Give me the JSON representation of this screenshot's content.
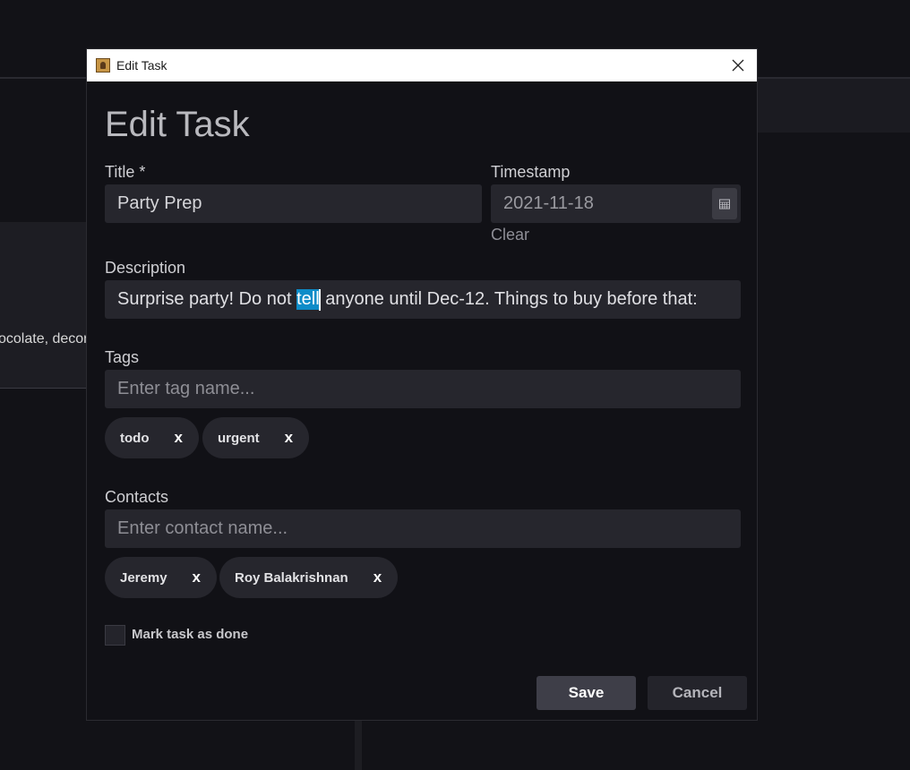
{
  "background": {
    "left_card_text": "ocolate, decorations, balloons"
  },
  "window": {
    "title": "Edit Task",
    "heading": "Edit Task"
  },
  "form": {
    "title_label": "Title *",
    "title_value": "Party Prep",
    "timestamp_label": "Timestamp",
    "timestamp_value": "2021-11-18",
    "clear_label": "Clear",
    "description_label": "Description",
    "description_before": "Surprise party! Do not ",
    "description_selected": "tell",
    "description_after": " anyone until Dec-12. Things to buy before that: ",
    "tags_label": "Tags",
    "tag_placeholder": "Enter tag name...",
    "tags": [
      "todo",
      "urgent"
    ],
    "contacts_label": "Contacts",
    "contact_placeholder": "Enter contact name...",
    "contacts": [
      "Jeremy",
      "Roy Balakrishnan"
    ],
    "remove_symbol": "x",
    "done_label": "Mark task as done",
    "done_checked": false
  },
  "buttons": {
    "save": "Save",
    "cancel": "Cancel"
  },
  "colors": {
    "selection": "#0d8cc8",
    "dialog_bg": "#111116",
    "field_bg": "#26262d"
  }
}
